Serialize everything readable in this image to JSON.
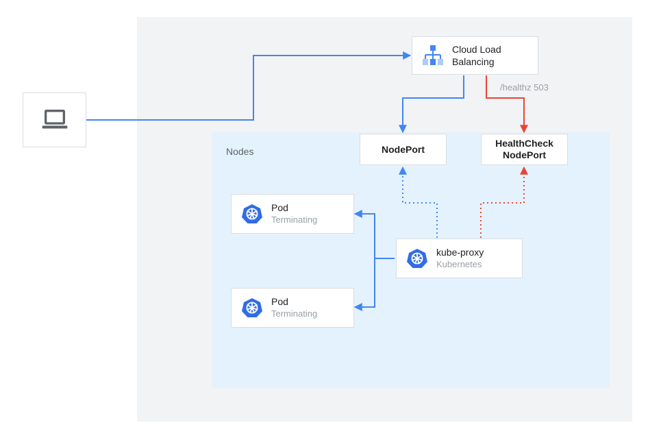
{
  "diagram": {
    "nodes_panel_label": "Nodes",
    "edge_label_healthz": "/healthz 503",
    "nodes": {
      "client": {
        "kind": "laptop"
      },
      "clb": {
        "title": "Cloud Load",
        "subtitle": "Balancing",
        "icon": "cloud-lb"
      },
      "nodeport": {
        "title": "NodePort"
      },
      "hc_nodeport": {
        "title_line1": "HealthCheck",
        "title_line2": "NodePort"
      },
      "pod1": {
        "title": "Pod",
        "subtitle": "Terminating",
        "icon": "kubernetes"
      },
      "pod2": {
        "title": "Pod",
        "subtitle": "Terminating",
        "icon": "kubernetes"
      },
      "kube_proxy": {
        "title": "kube-proxy",
        "subtitle": "Kubernetes",
        "icon": "kubernetes"
      }
    },
    "edges": [
      {
        "from": "client",
        "to": "clb",
        "style": "solid",
        "color": "blue"
      },
      {
        "from": "clb",
        "to": "nodeport",
        "style": "solid",
        "color": "blue"
      },
      {
        "from": "clb",
        "to": "hc_nodeport",
        "style": "solid",
        "color": "red",
        "label": "/healthz 503"
      },
      {
        "from": "kube_proxy",
        "to": "nodeport",
        "style": "dotted",
        "color": "blue"
      },
      {
        "from": "kube_proxy",
        "to": "hc_nodeport",
        "style": "dotted",
        "color": "red"
      },
      {
        "from": "kube_proxy",
        "to": "pod1",
        "style": "solid",
        "color": "blue"
      },
      {
        "from": "kube_proxy",
        "to": "pod2",
        "style": "solid",
        "color": "blue"
      }
    ],
    "colors": {
      "blue": "#4285f4",
      "red": "#ea4335",
      "panel_bg": "#f1f3f4",
      "nodes_bg": "#e4f2fd",
      "box_border": "#dadce0",
      "text_muted": "#9aa0a6",
      "k8s_wheel": "#326ce5"
    }
  }
}
